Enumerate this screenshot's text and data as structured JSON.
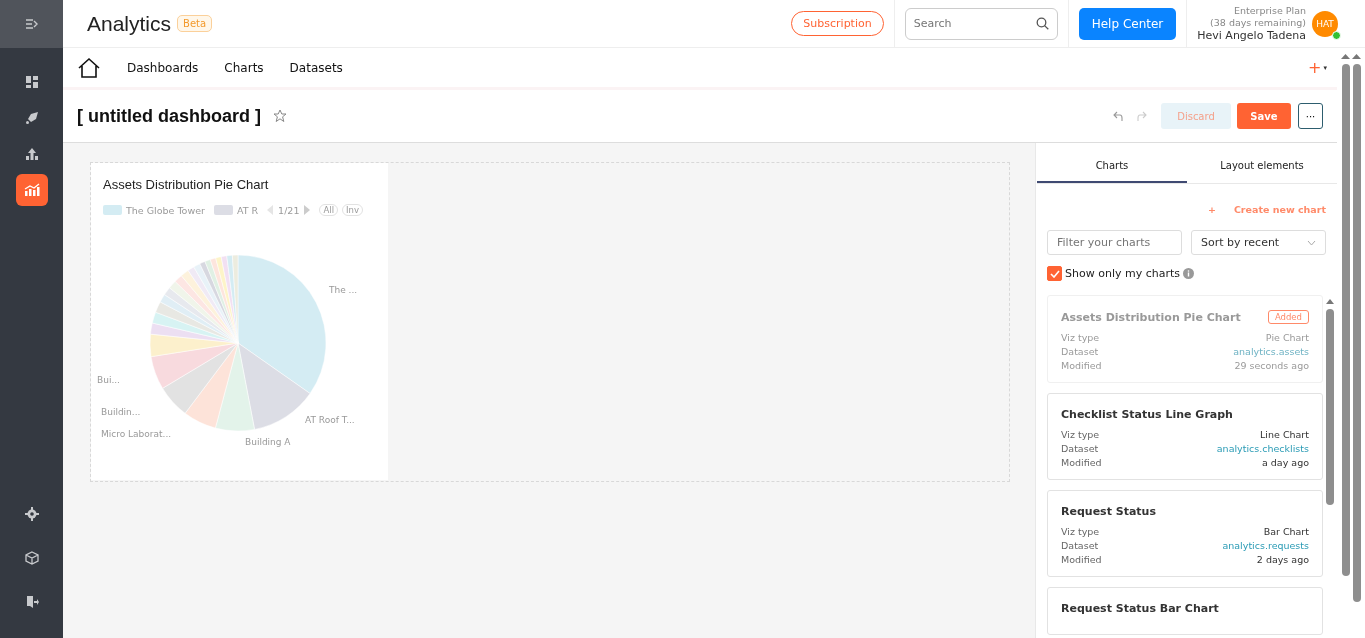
{
  "sidebar": {
    "items": [
      {
        "kind": "grid",
        "selected": false
      },
      {
        "kind": "rocket",
        "selected": false
      },
      {
        "kind": "upload",
        "selected": false
      },
      {
        "kind": "analytics",
        "selected": true
      }
    ],
    "bottom_items": [
      {
        "kind": "settings"
      },
      {
        "kind": "box"
      },
      {
        "kind": "logout"
      }
    ]
  },
  "header": {
    "title": "Analytics",
    "badge": "Beta",
    "subscription": "Subscription",
    "search": {
      "placeholder": "Search"
    },
    "help": "Help Center",
    "plan": "Enterprise Plan",
    "remaining": "(38 days remaining)",
    "user": "Hevi Angelo Tadena",
    "avatar": "HAT",
    "online": true
  },
  "nav": {
    "items": [
      "Dashboards",
      "Charts",
      "Datasets"
    ],
    "add": "+",
    "caret": "▾"
  },
  "dashboard": {
    "title": "[ untitled dashboard ]",
    "starred": false,
    "discard": "Discard",
    "save": "Save",
    "more": "···"
  },
  "chart_card": {
    "title": "Assets Distribution Pie Chart",
    "legend": [
      {
        "label": "The Globe Tower",
        "color": "#d4ecf3"
      },
      {
        "label": "AT R",
        "color": "#dcdde5"
      }
    ],
    "page": "1/21",
    "all": "All",
    "inv": "Inv",
    "labels": [
      "The ...",
      "Bui...",
      "Buildin...",
      "AT Roof T...",
      "Micro Laborat...",
      "Building A"
    ]
  },
  "panel": {
    "tabs": [
      {
        "label": "Charts",
        "selected": true
      },
      {
        "label": "Layout elements",
        "selected": false
      }
    ],
    "create_icon": "+",
    "create": "Create new chart",
    "filter": {
      "placeholder": "Filter your charts"
    },
    "sort": "Sort by recent",
    "only_mine": {
      "label": "Show only my charts",
      "checked": true
    },
    "charts": [
      {
        "title": "Assets Distribution Pie Chart",
        "added": true,
        "badge": "Added",
        "rows": [
          [
            "Viz type",
            "Pie Chart"
          ],
          [
            "Dataset",
            "analytics.assets"
          ],
          [
            "Modified",
            "29 seconds ago"
          ]
        ]
      },
      {
        "title": "Checklist Status Line Graph",
        "added": false,
        "rows": [
          [
            "Viz type",
            "Line Chart"
          ],
          [
            "Dataset",
            "analytics.checklists"
          ],
          [
            "Modified",
            "a day ago"
          ]
        ]
      },
      {
        "title": "Request Status",
        "added": false,
        "rows": [
          [
            "Viz type",
            "Bar Chart"
          ],
          [
            "Dataset",
            "analytics.requests"
          ],
          [
            "Modified",
            "2 days ago"
          ]
        ]
      },
      {
        "title": "Request Status Bar Chart",
        "added": false
      }
    ]
  }
}
